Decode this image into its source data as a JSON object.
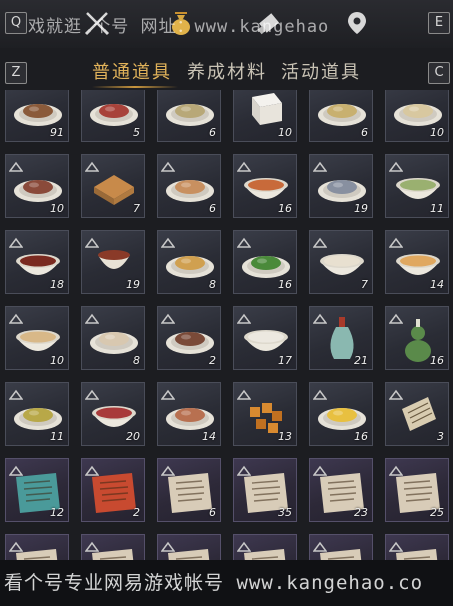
{
  "hotkeys": {
    "left_top": "Q",
    "right_top": "E",
    "left_tab": "Z",
    "right_tab": "C"
  },
  "watermark_top": "戏就逛 个号 网址：www.kangehao",
  "watermark_bottom": "看个号专业网易游戏帐号 www.kangehao.co",
  "top_icons": [
    "crossed-swords-icon",
    "money-bag-icon",
    "scroll-icon",
    "map-pin-icon"
  ],
  "tabs": [
    {
      "label": "普通道具",
      "active": true
    },
    {
      "label": "养成材料",
      "active": false
    },
    {
      "label": "活动道具",
      "active": false
    }
  ],
  "items": [
    {
      "name": "roast-dish",
      "qty": "91",
      "kind": "plate",
      "food": "#8a5a3a",
      "tag": false
    },
    {
      "name": "red-meat-plate",
      "qty": "5",
      "kind": "plate",
      "food": "#a8423a",
      "tag": false
    },
    {
      "name": "greens-plate",
      "qty": "6",
      "kind": "plate",
      "food": "#b8a878",
      "tag": false
    },
    {
      "name": "tofu-block",
      "qty": "10",
      "kind": "tofu",
      "food": "#e8e4dc",
      "tag": false
    },
    {
      "name": "mixed-bowl",
      "qty": "6",
      "kind": "plate",
      "food": "#c8b070",
      "tag": false
    },
    {
      "name": "shrimp-plate",
      "qty": "10",
      "kind": "plate",
      "food": "#d8c8a0",
      "tag": false
    },
    {
      "name": "pork-plate",
      "qty": "10",
      "kind": "plate",
      "food": "#8a4a3a",
      "tag": true
    },
    {
      "name": "square-cake",
      "qty": "7",
      "kind": "cake",
      "food": "#c88a4a",
      "tag": true
    },
    {
      "name": "sliced-cake",
      "qty": "6",
      "kind": "plate",
      "food": "#c89060",
      "tag": true
    },
    {
      "name": "spicy-soup",
      "qty": "16",
      "kind": "bowl",
      "food": "#c86a3a",
      "tag": true
    },
    {
      "name": "fish-plate",
      "qty": "19",
      "kind": "plate",
      "food": "#8890a0",
      "tag": true
    },
    {
      "name": "green-soup",
      "qty": "11",
      "kind": "bowl",
      "food": "#9ab070",
      "tag": true
    },
    {
      "name": "red-soup",
      "qty": "18",
      "kind": "bowl",
      "food": "#7a2a20",
      "tag": true
    },
    {
      "name": "tea-cup",
      "qty": "19",
      "kind": "cup",
      "food": "#8a3a28",
      "tag": true
    },
    {
      "name": "noodle-plate",
      "qty": "8",
      "kind": "plate",
      "food": "#d0a050",
      "tag": true
    },
    {
      "name": "green-vegetable",
      "qty": "16",
      "kind": "plate",
      "food": "#4a8a3a",
      "tag": true
    },
    {
      "name": "dumpling-bowl",
      "qty": "7",
      "kind": "bowl",
      "food": "#e8e0d0",
      "tag": true
    },
    {
      "name": "noodle-soup",
      "qty": "14",
      "kind": "bowl",
      "food": "#e0a860",
      "tag": true
    },
    {
      "name": "porridge-bowl",
      "qty": "10",
      "kind": "bowl",
      "food": "#d8b888",
      "tag": true
    },
    {
      "name": "dim-sum-plate",
      "qty": "8",
      "kind": "plate",
      "food": "#d8c8b0",
      "tag": true
    },
    {
      "name": "braised-meat",
      "qty": "2",
      "kind": "plate",
      "food": "#7a4a38",
      "tag": true
    },
    {
      "name": "rice-bowl",
      "qty": "17",
      "kind": "bowl",
      "food": "#ece8e0",
      "tag": true
    },
    {
      "name": "celadon-vase",
      "qty": "21",
      "kind": "vase",
      "food": "#8ab8b0",
      "tag": true
    },
    {
      "name": "green-gourd",
      "qty": "16",
      "kind": "gourd",
      "food": "#5a8a4a",
      "tag": true
    },
    {
      "name": "fried-rice",
      "qty": "11",
      "kind": "plate",
      "food": "#b8a848",
      "tag": true
    },
    {
      "name": "chili-bowl",
      "qty": "20",
      "kind": "bowl",
      "food": "#a83a3a",
      "tag": true
    },
    {
      "name": "roast-pork",
      "qty": "14",
      "kind": "plate",
      "food": "#b87050",
      "tag": true
    },
    {
      "name": "sweet-cubes",
      "qty": "13",
      "kind": "cubes",
      "food": "#d88a30",
      "tag": true
    },
    {
      "name": "scrambled-egg",
      "qty": "16",
      "kind": "plate",
      "food": "#e8c040",
      "tag": true
    },
    {
      "name": "letter-note",
      "qty": "3",
      "kind": "note",
      "food": "#d8ccb0",
      "tag": true
    },
    {
      "name": "teal-scroll",
      "qty": "12",
      "kind": "paper",
      "food": "#4a9a9a",
      "tag": true
    },
    {
      "name": "red-scroll",
      "qty": "2",
      "kind": "paper",
      "food": "#c84a30",
      "tag": true
    },
    {
      "name": "old-letter-a",
      "qty": "6",
      "kind": "paper",
      "food": "#d8ccb8",
      "tag": true
    },
    {
      "name": "old-letter-b",
      "qty": "35",
      "kind": "paper",
      "food": "#d8ccb8",
      "tag": true
    },
    {
      "name": "old-letter-c",
      "qty": "23",
      "kind": "paper",
      "food": "#d8ccb8",
      "tag": true
    },
    {
      "name": "old-letter-d",
      "qty": "25",
      "kind": "paper",
      "food": "#d8ccb8",
      "tag": true
    },
    {
      "name": "paper-row7-a",
      "qty": "",
      "kind": "paper",
      "food": "#d8ccb8",
      "tag": true
    },
    {
      "name": "paper-row7-b",
      "qty": "",
      "kind": "paper",
      "food": "#d8ccb8",
      "tag": true
    },
    {
      "name": "paper-row7-c",
      "qty": "",
      "kind": "paper",
      "food": "#d8ccb8",
      "tag": true
    },
    {
      "name": "paper-row7-d",
      "qty": "",
      "kind": "paper",
      "food": "#d8ccb8",
      "tag": true
    },
    {
      "name": "paper-row7-e",
      "qty": "",
      "kind": "paper",
      "food": "#d8ccb8",
      "tag": true
    },
    {
      "name": "paper-row7-f",
      "qty": "",
      "kind": "paper",
      "food": "#d8ccb8",
      "tag": true
    }
  ],
  "colors": {
    "accent": "#e0b25a",
    "tab_text": "#c9c3b5",
    "background": "#1c1d21"
  }
}
